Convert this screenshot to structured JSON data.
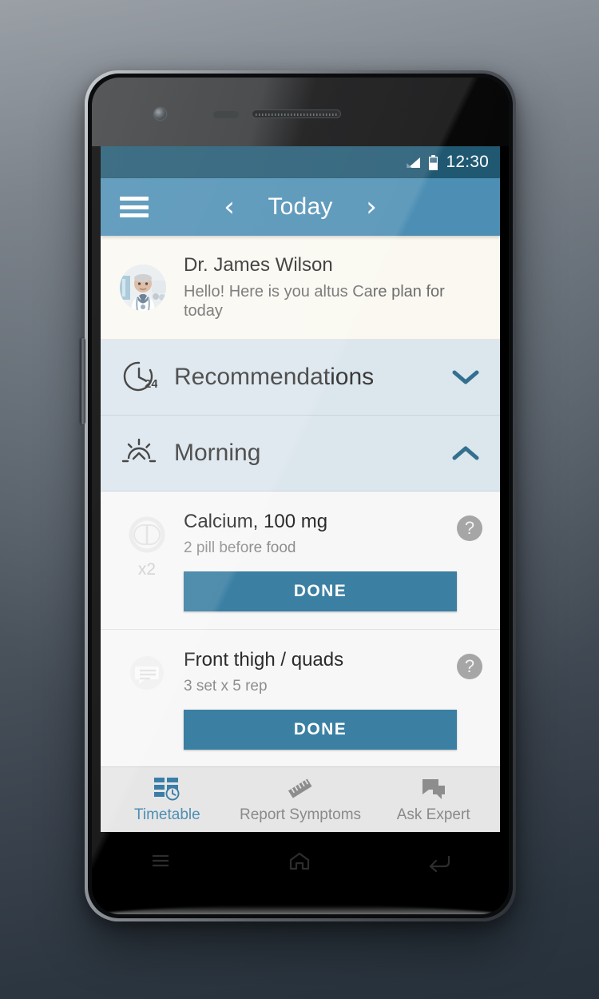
{
  "device": {
    "frame_name": "android-phone",
    "nav_keys": [
      "menu-key",
      "home-key",
      "back-key"
    ]
  },
  "status_bar": {
    "time": "12:30",
    "signal_icon": "signal-icon",
    "battery_icon": "battery-icon",
    "background": "#205872"
  },
  "app_bar": {
    "menu_icon": "hamburger-menu-icon",
    "prev_label": "‹",
    "title": "Today",
    "next_label": "›",
    "background": "#4d8fb4"
  },
  "greeting": {
    "avatar_name": "doctor-avatar",
    "name": "Dr. James Wilson",
    "message": "Hello! Here is you altus Care plan for today",
    "background": "#faf8f1"
  },
  "sections": [
    {
      "key": "recommendations",
      "icon": "clock-24-icon",
      "title": "Recommendations",
      "chevron": "chevron-down-icon",
      "expanded": false
    },
    {
      "key": "morning",
      "icon": "sunrise-icon",
      "title": "Morning",
      "chevron": "chevron-up-icon",
      "expanded": true
    }
  ],
  "tasks": [
    {
      "key": "calcium",
      "icon": "pill-icon",
      "count": "x2",
      "title": "Calcium, 100 mg",
      "subtitle": "2 pill before food",
      "action_label": "DONE",
      "help_label": "?"
    },
    {
      "key": "front-thigh-quads",
      "icon": "speech-bubble-icon",
      "count": "",
      "title": "Front thigh / quads",
      "subtitle": "3 set x 5 rep",
      "action_label": "DONE",
      "help_label": "?"
    }
  ],
  "tabs": [
    {
      "key": "timetable",
      "icon": "timetable-clock-icon",
      "label": "Timetable",
      "active": true
    },
    {
      "key": "report-symptoms",
      "icon": "ruler-icon",
      "label": "Report Symptoms",
      "active": false
    },
    {
      "key": "ask-expert",
      "icon": "chat-bubbles-icon",
      "label": "Ask Expert",
      "active": false
    }
  ],
  "colors": {
    "accent": "#4d8fb4",
    "status_bar": "#205872",
    "button": "#3b7fa3",
    "section_bg": "#dce6ed",
    "chevron": "#33708f"
  }
}
